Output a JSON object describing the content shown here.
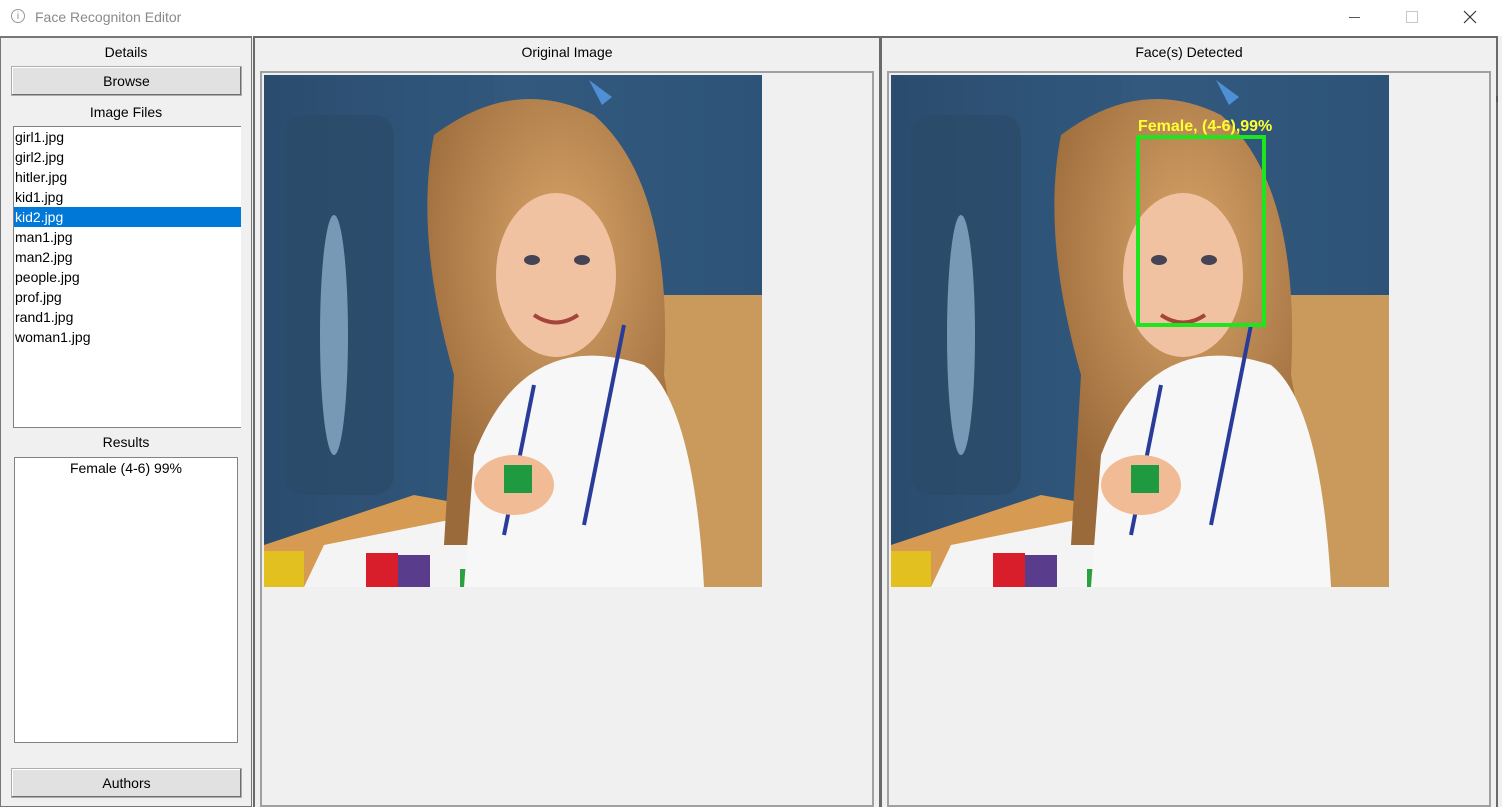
{
  "window": {
    "title": "Face Recogniton Editor"
  },
  "left": {
    "details_label": "Details",
    "browse_label": "Browse",
    "image_files_label": "Image Files",
    "files": [
      "girl1.jpg",
      "girl2.jpg",
      "hitler.jpg",
      "kid1.jpg",
      "kid2.jpg",
      "man1.jpg",
      "man2.jpg",
      "people.jpg",
      "prof.jpg",
      "rand1.jpg",
      "woman1.jpg"
    ],
    "selected_file": "kid2.jpg",
    "results_label": "Results",
    "results": [
      "Female (4-6) 99%"
    ],
    "authors_label": "Authors"
  },
  "original": {
    "title": "Original Image"
  },
  "detected": {
    "title": "Face(s) Detected",
    "face_label": "Female,  (4-6),99%"
  },
  "colors": {
    "selection": "#0078d7",
    "box": "#1ee61e",
    "label": "#ffff32"
  }
}
